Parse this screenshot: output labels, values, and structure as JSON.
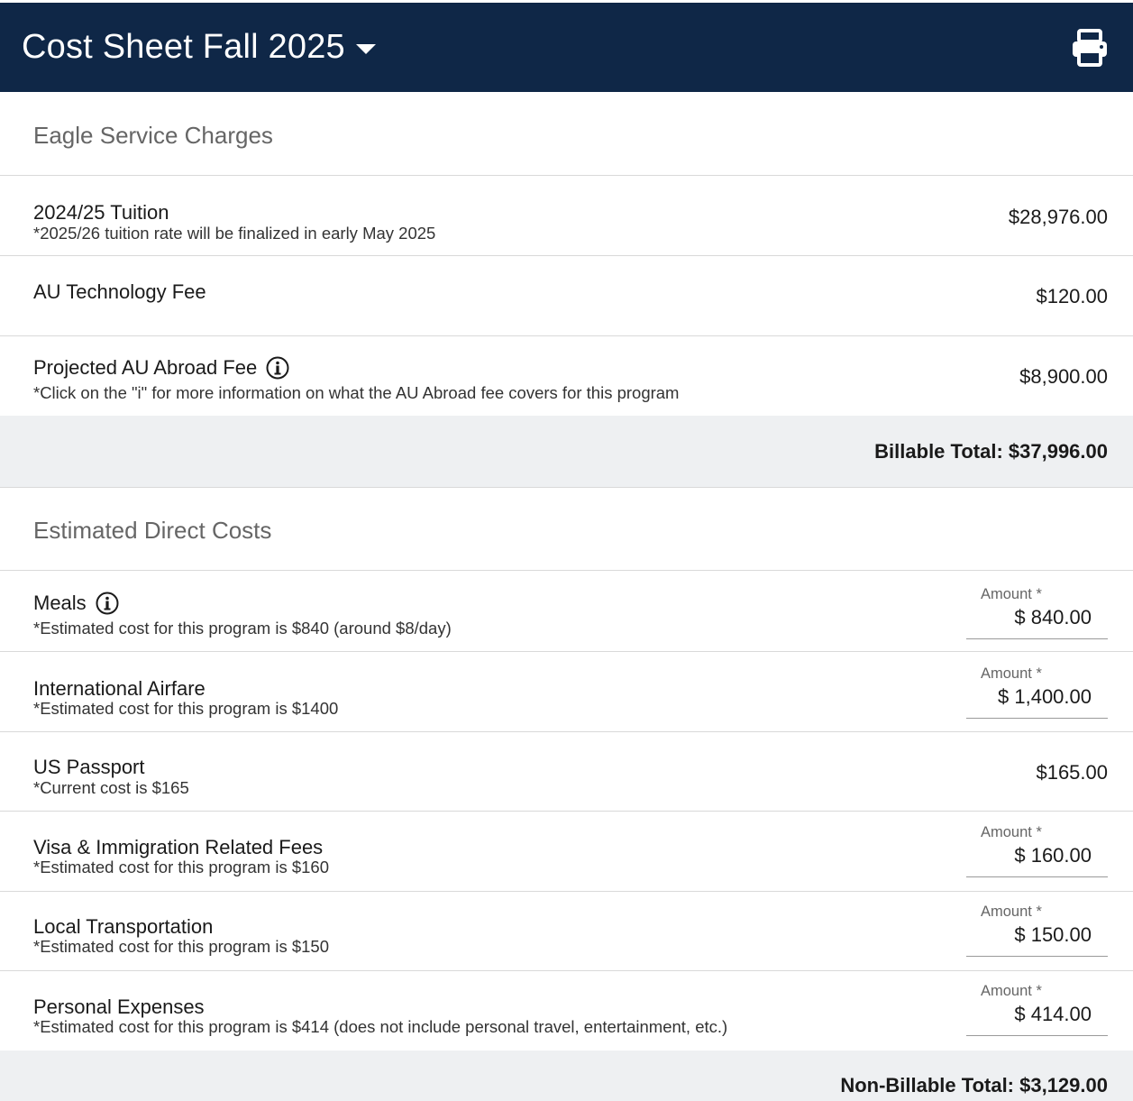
{
  "header": {
    "title": "Cost Sheet Fall 2025",
    "dropdown_icon": "chevron-down-icon",
    "print_icon": "printer-icon",
    "background_color": "#0f2747"
  },
  "sections": {
    "billable": {
      "heading": "Eagle Service Charges",
      "rows": [
        {
          "label": "2024/25 Tuition",
          "note": "*2025/26 tuition rate will be finalized in early May 2025",
          "value": "$28,976.00"
        },
        {
          "label": "AU Technology Fee",
          "value": "$120.00"
        },
        {
          "label": "Projected AU Abroad Fee",
          "note": "*Click on the \"i\" for more information on what the AU Abroad fee covers for this program",
          "value": "$8,900.00"
        }
      ],
      "total": "Billable Total: $37,996.00"
    },
    "direct": {
      "heading": "Estimated Direct Costs",
      "amount_label": "Amount *",
      "rows": [
        {
          "label": "Meals",
          "note": "*Estimated cost for this program is $840 (around $8/day)",
          "amount": "$ 840.00"
        },
        {
          "label": "International Airfare",
          "note": "*Estimated cost for this program is $1400",
          "amount": "$ 1,400.00"
        },
        {
          "label": "US Passport",
          "note": "*Current cost is $165",
          "value": "$165.00"
        },
        {
          "label": "Visa & Immigration Related Fees",
          "note": "*Estimated cost for this program is $160",
          "amount": "$ 160.00"
        },
        {
          "label": "Local Transportation",
          "note": "*Estimated cost for this program is $150",
          "amount": "$ 150.00"
        },
        {
          "label": "Personal Expenses",
          "note": "*Estimated cost for this program is $414 (does not include personal travel, entertainment, etc.)",
          "amount": "$ 414.00"
        }
      ],
      "total": "Non-Billable Total: $3,129.00"
    }
  }
}
